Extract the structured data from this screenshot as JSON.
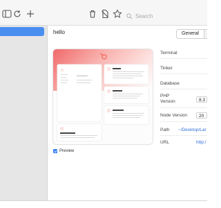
{
  "toolbar": {
    "search_placeholder": "Search",
    "icons": [
      "sidebar-icon",
      "refresh-icon",
      "plus-icon",
      "trash-icon",
      "document-off-icon",
      "star-icon",
      "search-icon"
    ]
  },
  "site": {
    "title": "hello"
  },
  "tabs": [
    {
      "label": "General",
      "active": true
    },
    {
      "label": "C",
      "active": false
    }
  ],
  "preview": {
    "label": "Preview",
    "checked": true
  },
  "details": [
    {
      "label": "Terminal",
      "value": ""
    },
    {
      "label": "Tinker",
      "value": ""
    },
    {
      "label": "Database",
      "value": ""
    },
    {
      "label": "PHP\nVersion",
      "value": "8.3"
    },
    {
      "label": "Node Version",
      "value": "20"
    },
    {
      "label": "Path",
      "value": "~/Desktop/Lar"
    },
    {
      "label": "URL",
      "value": "http:/"
    }
  ],
  "colors": {
    "accent": "#4a8ef0",
    "laravel": "#f05340"
  }
}
